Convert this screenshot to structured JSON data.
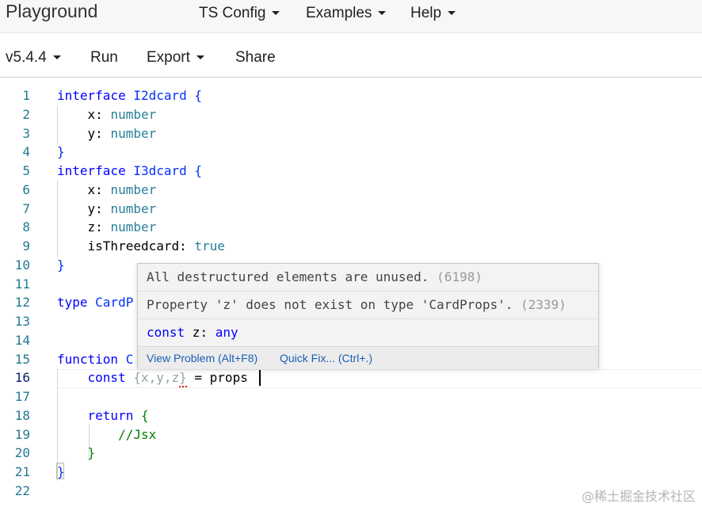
{
  "nav": {
    "brand": "Playground",
    "links": [
      {
        "label": "TS Config"
      },
      {
        "label": "Examples"
      },
      {
        "label": "Help"
      }
    ]
  },
  "toolbar": {
    "version": "v5.4.4",
    "run": "Run",
    "export": "Export",
    "share": "Share"
  },
  "editor": {
    "line_numbers": [
      "1",
      "2",
      "3",
      "4",
      "5",
      "6",
      "7",
      "8",
      "9",
      "10",
      "11",
      "12",
      "13",
      "14",
      "15",
      "16",
      "17",
      "18",
      "19",
      "20",
      "21",
      "22"
    ],
    "active_line": "16",
    "lines": {
      "l1_kw": "interface",
      "l1_rest": " I2dcard {",
      "l2_a": "    x: ",
      "l2_t": "number",
      "l3_a": "    y: ",
      "l3_t": "number",
      "l4": "}",
      "l5_kw": "interface",
      "l5_rest": " I3dcard {",
      "l6_a": "    x: ",
      "l6_t": "number",
      "l7_a": "    y: ",
      "l7_t": "number",
      "l8_a": "    z: ",
      "l8_t": "number",
      "l9_a": "    isThreedcard: ",
      "l9_t": "true",
      "l10": "}",
      "l12_kw": "type",
      "l12_rest": " CardP",
      "l15_kw": "function",
      "l15_rest": " C",
      "l16_kw": "    const ",
      "l16_dim": "{x,y,z}",
      "l16_rest": " = props",
      "l18_kw": "    return",
      "l18_rest": " {",
      "l19": "        //Jsx",
      "l20": "    }",
      "l21": "}"
    }
  },
  "hover": {
    "row1_msg": "All destructured elements are unused.",
    "row1_code": "(6198)",
    "row2_msg": "Property 'z' does not exist on type 'CardProps'.",
    "row2_code": "(2339)",
    "row3_kw": "const",
    "row3_name": " z: ",
    "row3_type": "any",
    "view_problem": "View Problem (Alt+F8)",
    "quick_fix": "Quick Fix... (Ctrl+.)"
  },
  "watermark": "@稀土掘金技术社区"
}
